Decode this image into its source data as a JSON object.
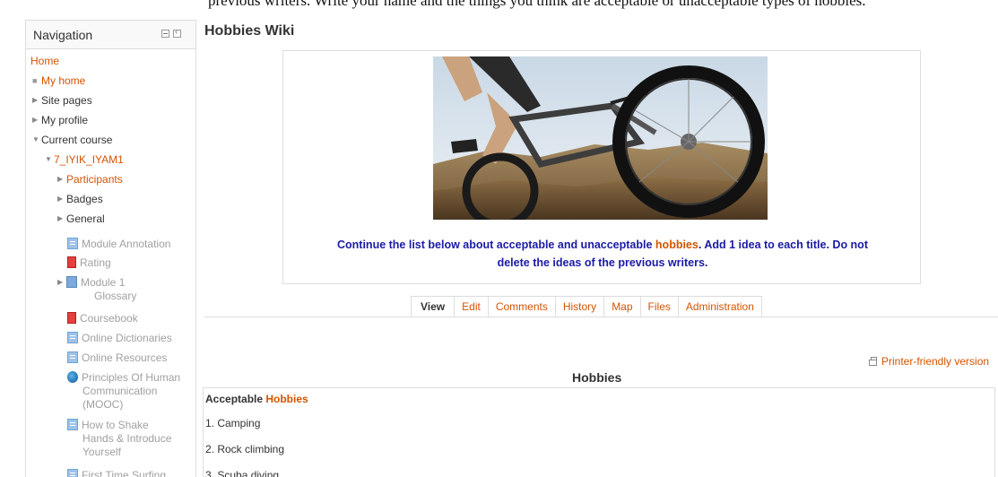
{
  "top_cut_text": "previous writers. Write your name and the things you think are acceptable or unacceptable types of hobbies.",
  "navigation": {
    "title": "Navigation",
    "home": "Home",
    "my_home": "My home",
    "site_pages": "Site pages",
    "my_profile": "My profile",
    "current_course": "Current course",
    "course": "7_IYIK_IYAM1",
    "participants": "Participants",
    "badges": "Badges",
    "general": "General",
    "activities": {
      "module_annotation": "Module Annotation",
      "rating": "Rating",
      "module_glossary_line1": "Module 1",
      "module_glossary_line2": "Glossary",
      "coursebook": "Coursebook",
      "online_dictionaries": "Online Dictionaries",
      "online_resources": "Online Resources",
      "principles_line1": "Principles Of Human",
      "principles_line2": "Communication",
      "principles_line3": "(MOOC)",
      "shake_line1": "How to Shake",
      "shake_line2": "Hands & Introduce",
      "shake_line3": "Yourself",
      "surfing": "First Time Surfing"
    }
  },
  "page_title": "Hobbies Wiki",
  "intro": {
    "part1": "Continue the list below about acceptable and unacceptable ",
    "highlight": "hobbies",
    "part2": ". Add 1 idea to each title. Do not",
    "line2": "delete the ideas of the previous writers."
  },
  "tabs": [
    "View",
    "Edit",
    "Comments",
    "History",
    "Map",
    "Files",
    "Administration"
  ],
  "printer_friendly": "Printer-friendly version",
  "wiki": {
    "heading": "Hobbies",
    "section_prefix": "Acceptable ",
    "section_link": "Hobbies",
    "items": [
      "1. Camping",
      "2. Rock climbing",
      "3. Scuba diving"
    ]
  },
  "colors": {
    "link": "#d35400",
    "intro_text": "#1a1aa6",
    "muted": "#a0a0a0"
  },
  "icons": [
    "printer-icon",
    "page-icon",
    "book-icon",
    "glossary-icon",
    "url-icon"
  ]
}
